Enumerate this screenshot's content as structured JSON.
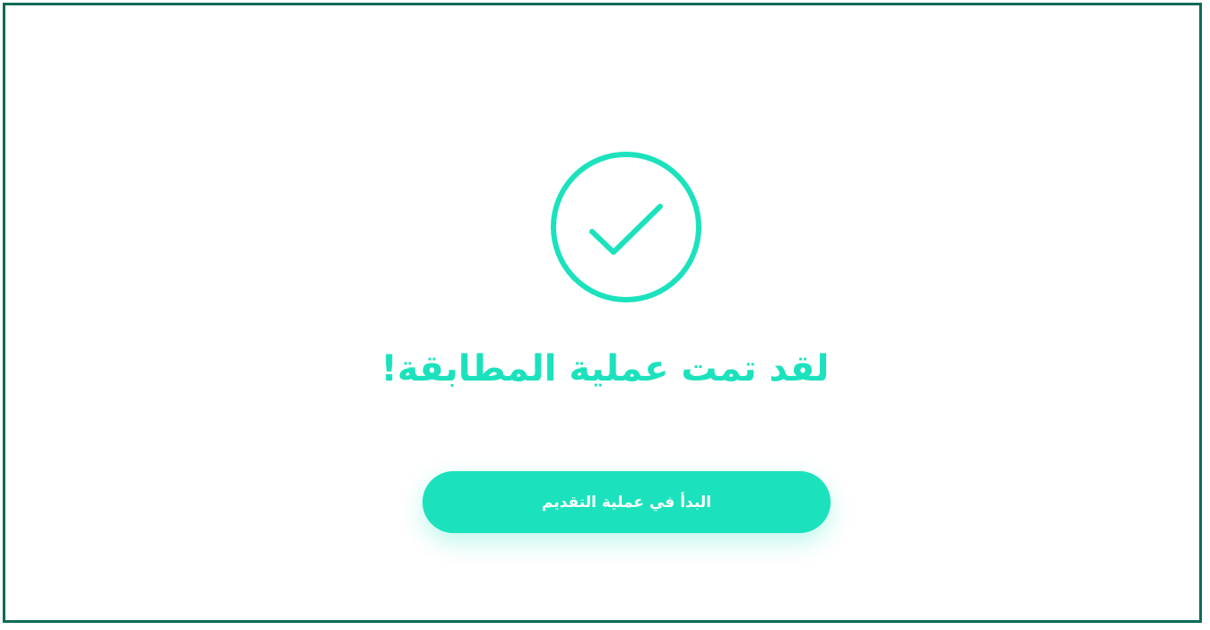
{
  "colors": {
    "accent": "#1be2bd",
    "frame_border": "#0d6b57",
    "background": "#ffffff",
    "button_text": "#ffffff"
  },
  "status": {
    "icon": "check-circle-icon",
    "title": "لقد تمت عملية المطابقة!"
  },
  "actions": {
    "start_application_label": "البدأ في عملية التقديم"
  }
}
